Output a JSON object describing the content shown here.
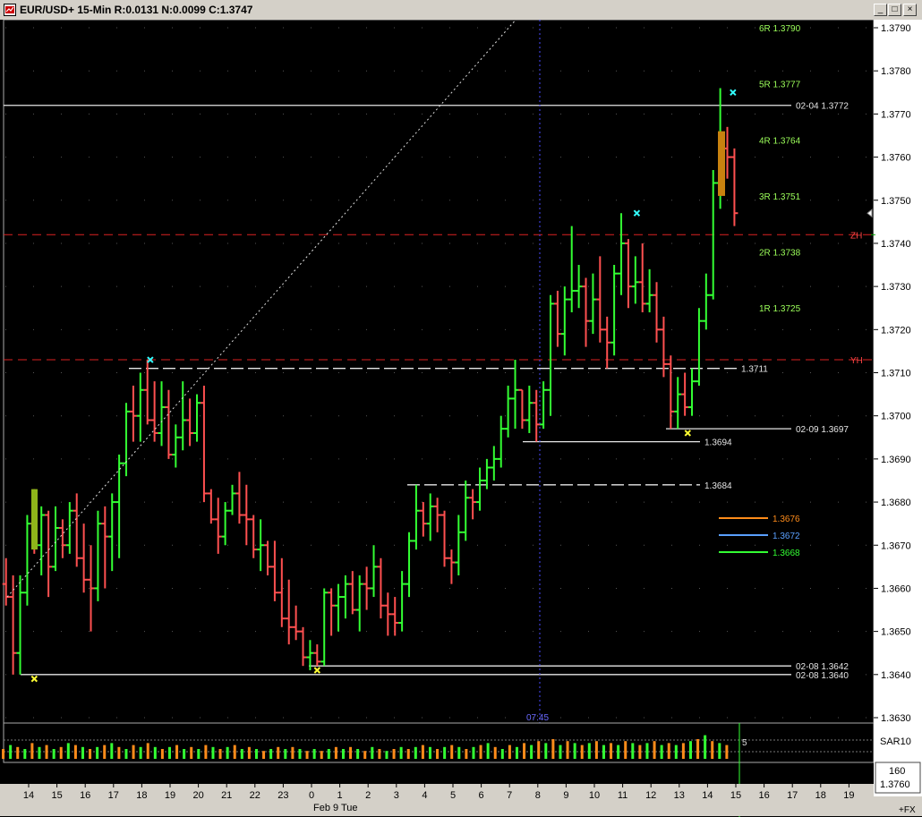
{
  "window": {
    "title": "EUR/USD+ 15-Min R:0.0131 N:0.0099 C:1.3747",
    "buttons": {
      "minimize": "_",
      "restore": "□",
      "close": "×"
    }
  },
  "chart_data": {
    "type": "bar",
    "symbol": "EUR/USD+",
    "timeframe": "15-Min",
    "ylim": [
      1.363,
      1.379
    ],
    "y_ticks": [
      "1.3790",
      "1.3780",
      "1.3770",
      "1.3760",
      "1.3750",
      "1.3740",
      "1.3730",
      "1.3720",
      "1.3710",
      "1.3700",
      "1.3690",
      "1.3680",
      "1.3670",
      "1.3660",
      "1.3650",
      "1.3640",
      "1.3630"
    ],
    "x_tick_labels": [
      "14",
      "15",
      "16",
      "17",
      "18",
      "19",
      "20",
      "21",
      "22",
      "23",
      "0",
      "1",
      "2",
      "3",
      "4",
      "5",
      "6",
      "7",
      "8",
      "9",
      "10",
      "11",
      "12",
      "13",
      "14",
      "15",
      "16",
      "17",
      "18",
      "19"
    ],
    "x_date_label": "Feb 9 Tue",
    "cursor_time_label": "07:45",
    "current_price_label": "1.3747",
    "pivot_levels": [
      {
        "label": "6R 1.3790",
        "value": 1.379
      },
      {
        "label": "5R 1.3777",
        "value": 1.3777
      },
      {
        "label": "4R 1.3764",
        "value": 1.3764
      },
      {
        "label": "3R 1.3751",
        "value": 1.3751
      },
      {
        "label": "2R 1.3738",
        "value": 1.3738
      },
      {
        "label": "1R 1.3725",
        "value": 1.3725
      }
    ],
    "red_levels": [
      {
        "label": "ZH",
        "value": 1.3742
      },
      {
        "label": "YH",
        "value": 1.3713
      }
    ],
    "horizontal_levels": [
      {
        "label": "02-04  1.3772",
        "value": 1.3772,
        "style": "solid"
      },
      {
        "label": "1.3711",
        "value": 1.3711,
        "style": "dashed"
      },
      {
        "label": "02-09  1.3697",
        "value": 1.3697,
        "style": "solid"
      },
      {
        "label": "1.3694",
        "value": 1.3694,
        "style": "solid"
      },
      {
        "label": "1.3684",
        "value": 1.3684,
        "style": "dashed"
      },
      {
        "label": "02-08  1.3642",
        "value": 1.3642,
        "style": "solid"
      },
      {
        "label": "02-08  1.3640",
        "value": 1.364,
        "style": "solid"
      }
    ],
    "legend": [
      {
        "label": "1.3676",
        "color": "#ff8c1a"
      },
      {
        "label": "1.3672",
        "color": "#5aa0ff"
      },
      {
        "label": "1.3668",
        "color": "#33ff33"
      }
    ],
    "swing_markers": [
      {
        "x": 0.2,
        "y": 1.3639,
        "color": "#ffff33"
      },
      {
        "x": 4.3,
        "y": 1.3713,
        "color": "#33ffff"
      },
      {
        "x": 10.2,
        "y": 1.3641,
        "color": "#ffff33"
      },
      {
        "x": 21.5,
        "y": 1.3747,
        "color": "#33ffff"
      },
      {
        "x": 23.3,
        "y": 1.3696,
        "color": "#ffff33"
      },
      {
        "x": 24.9,
        "y": 1.3775,
        "color": "#33ffff"
      }
    ],
    "volume_indicator": {
      "label": "SAR10",
      "value_label": "5",
      "counter_label": "160",
      "price_label": "1.3760"
    },
    "bottom_right_label": "+FX",
    "bars": [
      {
        "t": -0.8,
        "o": 1.3661,
        "h": 1.3667,
        "l": 1.3656,
        "c": 1.3658
      },
      {
        "t": -0.55,
        "o": 1.3658,
        "h": 1.3663,
        "l": 1.364,
        "c": 1.3645
      },
      {
        "t": -0.3,
        "o": 1.3645,
        "h": 1.3663,
        "l": 1.364,
        "c": 1.3659
      },
      {
        "t": -0.05,
        "o": 1.3659,
        "h": 1.3677,
        "l": 1.3656,
        "c": 1.3675
      },
      {
        "t": 0.2,
        "o": 1.3675,
        "h": 1.3683,
        "l": 1.3668,
        "c": 1.367
      },
      {
        "t": 0.45,
        "o": 1.367,
        "h": 1.3679,
        "l": 1.3663,
        "c": 1.3677
      },
      {
        "t": 0.7,
        "o": 1.3677,
        "h": 1.3678,
        "l": 1.3658,
        "c": 1.3665
      },
      {
        "t": 0.95,
        "o": 1.3665,
        "h": 1.3679,
        "l": 1.3664,
        "c": 1.3674
      },
      {
        "t": 1.2,
        "o": 1.3674,
        "h": 1.3676,
        "l": 1.3667,
        "c": 1.367
      },
      {
        "t": 1.45,
        "o": 1.367,
        "h": 1.368,
        "l": 1.3668,
        "c": 1.3678
      },
      {
        "t": 1.7,
        "o": 1.3678,
        "h": 1.3682,
        "l": 1.3665,
        "c": 1.3667
      },
      {
        "t": 1.95,
        "o": 1.3667,
        "h": 1.3675,
        "l": 1.3659,
        "c": 1.3662
      },
      {
        "t": 2.2,
        "o": 1.3662,
        "h": 1.367,
        "l": 1.365,
        "c": 1.366
      },
      {
        "t": 2.45,
        "o": 1.366,
        "h": 1.3678,
        "l": 1.3657,
        "c": 1.3675
      },
      {
        "t": 2.7,
        "o": 1.3675,
        "h": 1.3679,
        "l": 1.366,
        "c": 1.3672
      },
      {
        "t": 2.95,
        "o": 1.3672,
        "h": 1.3682,
        "l": 1.3664,
        "c": 1.368
      },
      {
        "t": 3.2,
        "o": 1.368,
        "h": 1.3691,
        "l": 1.3667,
        "c": 1.3689
      },
      {
        "t": 3.45,
        "o": 1.3689,
        "h": 1.3703,
        "l": 1.3686,
        "c": 1.3701
      },
      {
        "t": 3.7,
        "o": 1.3701,
        "h": 1.3707,
        "l": 1.3694,
        "c": 1.37
      },
      {
        "t": 3.95,
        "o": 1.37,
        "h": 1.371,
        "l": 1.3694,
        "c": 1.3706
      },
      {
        "t": 4.2,
        "o": 1.3706,
        "h": 1.3713,
        "l": 1.3698,
        "c": 1.3699
      },
      {
        "t": 4.45,
        "o": 1.3699,
        "h": 1.3708,
        "l": 1.3694,
        "c": 1.3696
      },
      {
        "t": 4.7,
        "o": 1.3696,
        "h": 1.3708,
        "l": 1.3693,
        "c": 1.3702
      },
      {
        "t": 4.95,
        "o": 1.3702,
        "h": 1.3706,
        "l": 1.369,
        "c": 1.3691
      },
      {
        "t": 5.2,
        "o": 1.3691,
        "h": 1.3698,
        "l": 1.3688,
        "c": 1.3695
      },
      {
        "t": 5.45,
        "o": 1.3695,
        "h": 1.3708,
        "l": 1.3692,
        "c": 1.3699
      },
      {
        "t": 5.7,
        "o": 1.3699,
        "h": 1.3704,
        "l": 1.3693,
        "c": 1.3696
      },
      {
        "t": 5.95,
        "o": 1.3696,
        "h": 1.3705,
        "l": 1.3694,
        "c": 1.3703
      },
      {
        "t": 6.2,
        "o": 1.3703,
        "h": 1.3707,
        "l": 1.368,
        "c": 1.3682
      },
      {
        "t": 6.45,
        "o": 1.3682,
        "h": 1.3683,
        "l": 1.3675,
        "c": 1.3676
      },
      {
        "t": 6.7,
        "o": 1.3676,
        "h": 1.3681,
        "l": 1.3668,
        "c": 1.3672
      },
      {
        "t": 6.95,
        "o": 1.3672,
        "h": 1.368,
        "l": 1.367,
        "c": 1.3678
      },
      {
        "t": 7.2,
        "o": 1.3678,
        "h": 1.3684,
        "l": 1.3677,
        "c": 1.3682
      },
      {
        "t": 7.45,
        "o": 1.3682,
        "h": 1.3687,
        "l": 1.3675,
        "c": 1.3677
      },
      {
        "t": 7.7,
        "o": 1.3677,
        "h": 1.3684,
        "l": 1.367,
        "c": 1.3676
      },
      {
        "t": 7.95,
        "o": 1.3676,
        "h": 1.3677,
        "l": 1.3667,
        "c": 1.3669
      },
      {
        "t": 8.2,
        "o": 1.3669,
        "h": 1.3676,
        "l": 1.3664,
        "c": 1.367
      },
      {
        "t": 8.45,
        "o": 1.367,
        "h": 1.3671,
        "l": 1.3663,
        "c": 1.3665
      },
      {
        "t": 8.7,
        "o": 1.3665,
        "h": 1.3671,
        "l": 1.3657,
        "c": 1.3659
      },
      {
        "t": 8.95,
        "o": 1.3659,
        "h": 1.3667,
        "l": 1.3651,
        "c": 1.3653
      },
      {
        "t": 9.2,
        "o": 1.3653,
        "h": 1.3662,
        "l": 1.3647,
        "c": 1.3651
      },
      {
        "t": 9.45,
        "o": 1.3651,
        "h": 1.3656,
        "l": 1.3648,
        "c": 1.365
      },
      {
        "t": 9.7,
        "o": 1.365,
        "h": 1.3651,
        "l": 1.3642,
        "c": 1.3644
      },
      {
        "t": 9.95,
        "o": 1.3644,
        "h": 1.3648,
        "l": 1.3641,
        "c": 1.3645
      },
      {
        "t": 10.2,
        "o": 1.3645,
        "h": 1.3647,
        "l": 1.3642,
        "c": 1.3643
      },
      {
        "t": 10.45,
        "o": 1.3643,
        "h": 1.366,
        "l": 1.3642,
        "c": 1.3659
      },
      {
        "t": 10.7,
        "o": 1.3659,
        "h": 1.366,
        "l": 1.3649,
        "c": 1.3656
      },
      {
        "t": 10.95,
        "o": 1.3656,
        "h": 1.3661,
        "l": 1.365,
        "c": 1.3658
      },
      {
        "t": 11.2,
        "o": 1.3658,
        "h": 1.3663,
        "l": 1.3653,
        "c": 1.3661
      },
      {
        "t": 11.45,
        "o": 1.3661,
        "h": 1.3664,
        "l": 1.3654,
        "c": 1.3655
      },
      {
        "t": 11.7,
        "o": 1.3655,
        "h": 1.3663,
        "l": 1.365,
        "c": 1.3661
      },
      {
        "t": 11.95,
        "o": 1.3661,
        "h": 1.3665,
        "l": 1.3655,
        "c": 1.366
      },
      {
        "t": 12.2,
        "o": 1.366,
        "h": 1.367,
        "l": 1.3658,
        "c": 1.3665
      },
      {
        "t": 12.45,
        "o": 1.3665,
        "h": 1.3667,
        "l": 1.3653,
        "c": 1.3656
      },
      {
        "t": 12.7,
        "o": 1.3656,
        "h": 1.3659,
        "l": 1.3649,
        "c": 1.3654
      },
      {
        "t": 12.95,
        "o": 1.3654,
        "h": 1.3658,
        "l": 1.3649,
        "c": 1.3652
      },
      {
        "t": 13.2,
        "o": 1.3652,
        "h": 1.3664,
        "l": 1.365,
        "c": 1.3661
      },
      {
        "t": 13.45,
        "o": 1.3661,
        "h": 1.3673,
        "l": 1.3658,
        "c": 1.3671
      },
      {
        "t": 13.7,
        "o": 1.3671,
        "h": 1.3684,
        "l": 1.3669,
        "c": 1.3678
      },
      {
        "t": 13.95,
        "o": 1.3678,
        "h": 1.368,
        "l": 1.3672,
        "c": 1.3675
      },
      {
        "t": 14.2,
        "o": 1.3675,
        "h": 1.3682,
        "l": 1.3671,
        "c": 1.3679
      },
      {
        "t": 14.45,
        "o": 1.3679,
        "h": 1.3681,
        "l": 1.3673,
        "c": 1.3677
      },
      {
        "t": 14.7,
        "o": 1.3677,
        "h": 1.3678,
        "l": 1.3665,
        "c": 1.3667
      },
      {
        "t": 14.95,
        "o": 1.3667,
        "h": 1.3669,
        "l": 1.3661,
        "c": 1.3666
      },
      {
        "t": 15.2,
        "o": 1.3666,
        "h": 1.3677,
        "l": 1.3663,
        "c": 1.3673
      },
      {
        "t": 15.45,
        "o": 1.3673,
        "h": 1.3685,
        "l": 1.3671,
        "c": 1.3681
      },
      {
        "t": 15.7,
        "o": 1.3681,
        "h": 1.3683,
        "l": 1.3676,
        "c": 1.368
      },
      {
        "t": 15.95,
        "o": 1.368,
        "h": 1.3688,
        "l": 1.3678,
        "c": 1.3685
      },
      {
        "t": 16.2,
        "o": 1.3685,
        "h": 1.369,
        "l": 1.3683,
        "c": 1.3688
      },
      {
        "t": 16.45,
        "o": 1.3688,
        "h": 1.3693,
        "l": 1.3685,
        "c": 1.369
      },
      {
        "t": 16.7,
        "o": 1.369,
        "h": 1.37,
        "l": 1.3688,
        "c": 1.3697
      },
      {
        "t": 16.95,
        "o": 1.3697,
        "h": 1.3707,
        "l": 1.3695,
        "c": 1.3704
      },
      {
        "t": 17.2,
        "o": 1.3704,
        "h": 1.3713,
        "l": 1.3697,
        "c": 1.3706
      },
      {
        "t": 17.45,
        "o": 1.3706,
        "h": 1.3706,
        "l": 1.3697,
        "c": 1.3699
      },
      {
        "t": 17.7,
        "o": 1.3699,
        "h": 1.3707,
        "l": 1.3696,
        "c": 1.3703
      },
      {
        "t": 17.95,
        "o": 1.3703,
        "h": 1.3706,
        "l": 1.3694,
        "c": 1.3698
      },
      {
        "t": 18.2,
        "o": 1.3698,
        "h": 1.3708,
        "l": 1.3697,
        "c": 1.3706
      },
      {
        "t": 18.45,
        "o": 1.3706,
        "h": 1.3728,
        "l": 1.37,
        "c": 1.3726
      },
      {
        "t": 18.7,
        "o": 1.3726,
        "h": 1.3729,
        "l": 1.3716,
        "c": 1.3719
      },
      {
        "t": 18.95,
        "o": 1.3719,
        "h": 1.373,
        "l": 1.3714,
        "c": 1.3727
      },
      {
        "t": 19.2,
        "o": 1.3727,
        "h": 1.3744,
        "l": 1.3724,
        "c": 1.3729
      },
      {
        "t": 19.45,
        "o": 1.3729,
        "h": 1.3735,
        "l": 1.3725,
        "c": 1.373
      },
      {
        "t": 19.7,
        "o": 1.373,
        "h": 1.3732,
        "l": 1.3716,
        "c": 1.3722
      },
      {
        "t": 19.95,
        "o": 1.3722,
        "h": 1.3733,
        "l": 1.3719,
        "c": 1.3727
      },
      {
        "t": 20.2,
        "o": 1.3727,
        "h": 1.3737,
        "l": 1.3717,
        "c": 1.372
      },
      {
        "t": 20.45,
        "o": 1.372,
        "h": 1.3723,
        "l": 1.3711,
        "c": 1.3717
      },
      {
        "t": 20.7,
        "o": 1.3717,
        "h": 1.3735,
        "l": 1.3714,
        "c": 1.3733
      },
      {
        "t": 20.95,
        "o": 1.3733,
        "h": 1.3747,
        "l": 1.3728,
        "c": 1.374
      },
      {
        "t": 21.2,
        "o": 1.374,
        "h": 1.3741,
        "l": 1.3725,
        "c": 1.373
      },
      {
        "t": 21.45,
        "o": 1.373,
        "h": 1.3737,
        "l": 1.3726,
        "c": 1.3731
      },
      {
        "t": 21.7,
        "o": 1.3731,
        "h": 1.374,
        "l": 1.3724,
        "c": 1.3726
      },
      {
        "t": 21.95,
        "o": 1.3726,
        "h": 1.3734,
        "l": 1.3724,
        "c": 1.3728
      },
      {
        "t": 22.2,
        "o": 1.3728,
        "h": 1.3731,
        "l": 1.3717,
        "c": 1.372
      },
      {
        "t": 22.45,
        "o": 1.372,
        "h": 1.3723,
        "l": 1.3709,
        "c": 1.3712
      },
      {
        "t": 22.7,
        "o": 1.3712,
        "h": 1.3714,
        "l": 1.3697,
        "c": 1.3701
      },
      {
        "t": 22.95,
        "o": 1.3701,
        "h": 1.3709,
        "l": 1.3697,
        "c": 1.3705
      },
      {
        "t": 23.2,
        "o": 1.3705,
        "h": 1.371,
        "l": 1.37,
        "c": 1.3702
      },
      {
        "t": 23.45,
        "o": 1.3702,
        "h": 1.3711,
        "l": 1.37,
        "c": 1.3708
      },
      {
        "t": 23.7,
        "o": 1.3708,
        "h": 1.3725,
        "l": 1.3707,
        "c": 1.3722
      },
      {
        "t": 23.95,
        "o": 1.3722,
        "h": 1.3733,
        "l": 1.372,
        "c": 1.3728
      },
      {
        "t": 24.2,
        "o": 1.3728,
        "h": 1.3757,
        "l": 1.3727,
        "c": 1.3754
      },
      {
        "t": 24.45,
        "o": 1.3754,
        "h": 1.3776,
        "l": 1.3748,
        "c": 1.3762
      },
      {
        "t": 24.7,
        "o": 1.3762,
        "h": 1.3767,
        "l": 1.3755,
        "c": 1.376
      },
      {
        "t": 24.95,
        "o": 1.376,
        "h": 1.3762,
        "l": 1.3744,
        "c": 1.3747
      }
    ],
    "volume": [
      5,
      7,
      6,
      5,
      8,
      6,
      7,
      5,
      6,
      8,
      7,
      6,
      5,
      6,
      7,
      8,
      6,
      5,
      7,
      6,
      8,
      6,
      5,
      6,
      7,
      5,
      6,
      5,
      7,
      6,
      5,
      6,
      7,
      5,
      6,
      5,
      4,
      5,
      6,
      5,
      6,
      5,
      4,
      5,
      4,
      5,
      6,
      5,
      6,
      5,
      4,
      6,
      5,
      4,
      5,
      6,
      5,
      6,
      7,
      6,
      5,
      6,
      7,
      6,
      5,
      6,
      7,
      8,
      6,
      5,
      7,
      6,
      8,
      7,
      9,
      8,
      10,
      7,
      9,
      8,
      7,
      8,
      9,
      7,
      8,
      7,
      9,
      8,
      7,
      8,
      9,
      7,
      8,
      7,
      8,
      9,
      10,
      12,
      9,
      8,
      7
    ]
  }
}
